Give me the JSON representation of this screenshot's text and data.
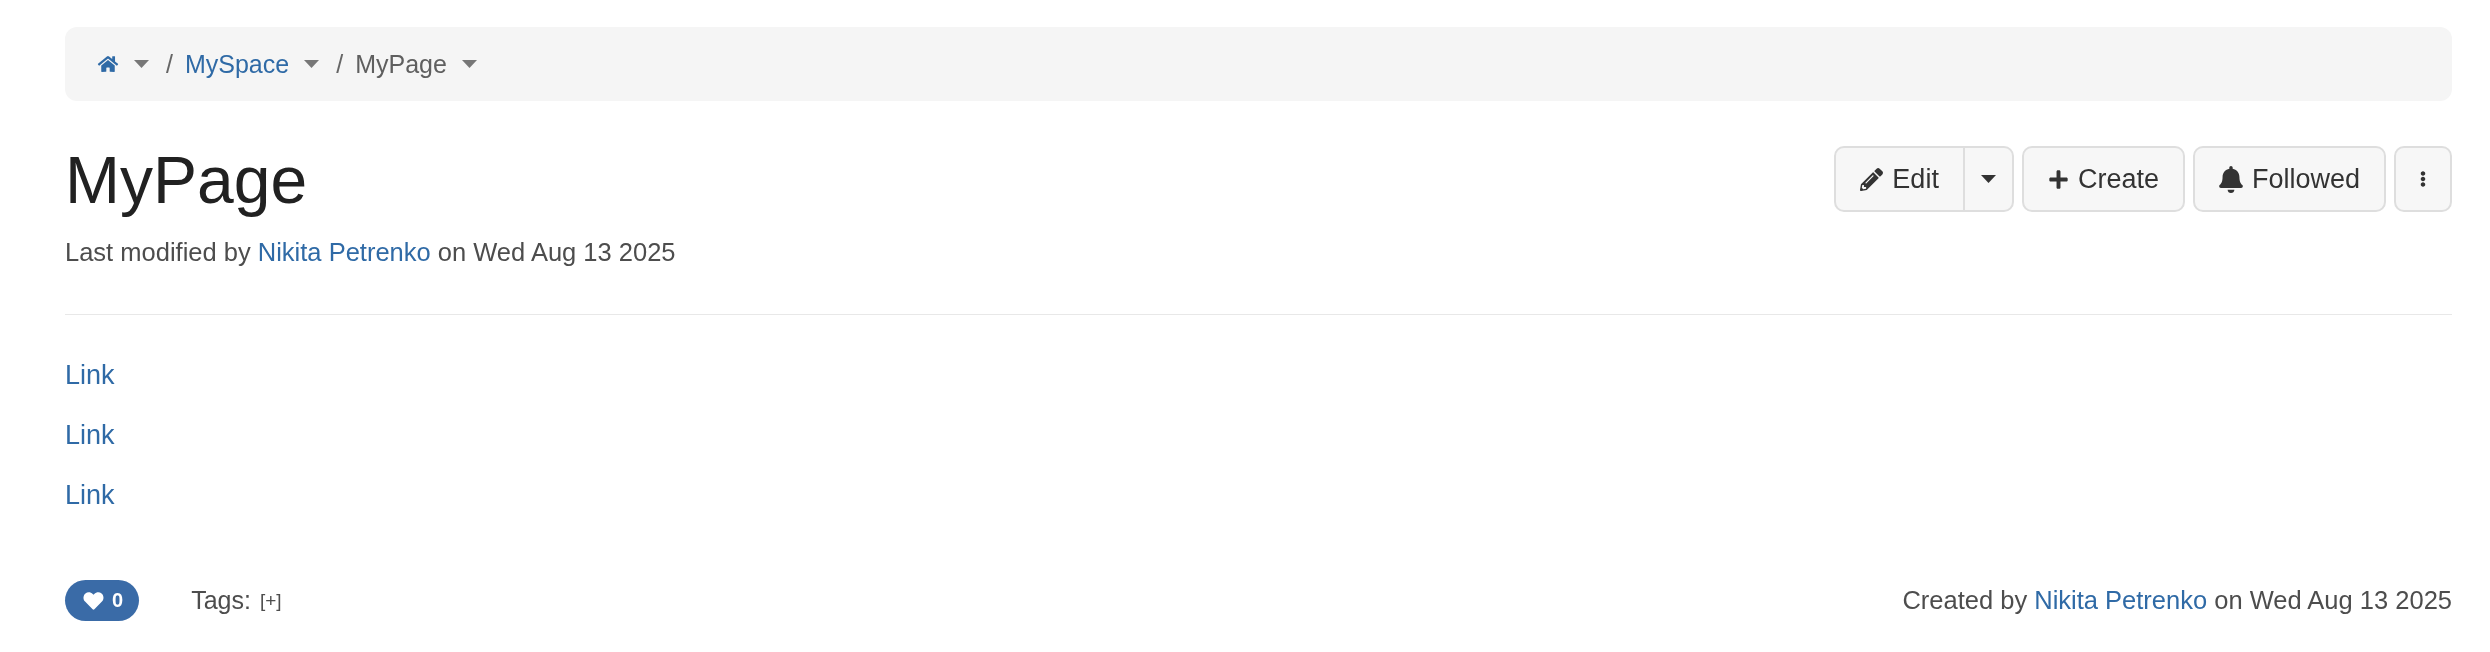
{
  "breadcrumb": [
    {
      "kind": "home",
      "dropdown": true
    },
    {
      "kind": "link",
      "separator": "/",
      "label": "MySpace",
      "dropdown": true
    },
    {
      "kind": "current",
      "separator": "/",
      "label": "MyPage",
      "dropdown": true
    }
  ],
  "page": {
    "title": "MyPage",
    "modified": {
      "before": "Last modified by",
      "author": "Nikita Petrenko",
      "after": "on Wed Aug 13 2025"
    }
  },
  "actions": [
    {
      "kind": "edit",
      "label": "Edit",
      "split": true
    },
    {
      "kind": "create",
      "label": "Create"
    },
    {
      "kind": "follow",
      "label": "Followed"
    },
    {
      "kind": "more"
    }
  ],
  "links": [
    {
      "label": "Link"
    },
    {
      "label": "Link"
    },
    {
      "label": "Link"
    }
  ],
  "footer": {
    "likes": "0",
    "tags": {
      "label": "Tags:",
      "add": "[+]"
    },
    "created": {
      "before": "Created by",
      "author": "Nikita Petrenko",
      "after": "on Wed Aug 13 2025"
    }
  }
}
